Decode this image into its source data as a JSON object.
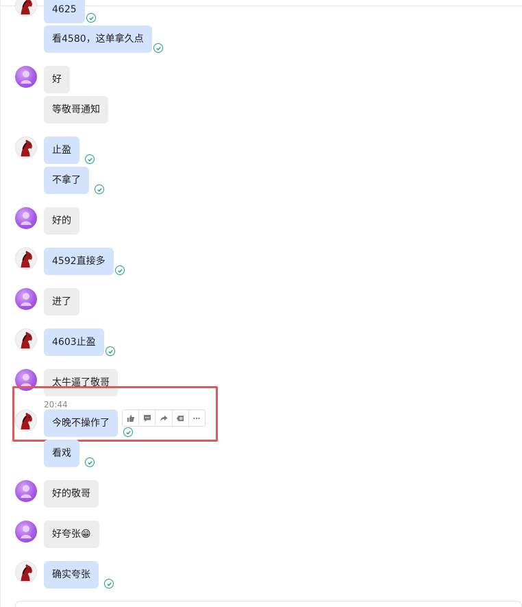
{
  "timestamp": "20:44",
  "messages": [
    {
      "text": "4625",
      "side": "mine"
    },
    {
      "text": "看4580，这单拿久点",
      "side": "mine"
    },
    {
      "text": "好",
      "side": "theirs"
    },
    {
      "text": "等敬哥通知",
      "side": "theirs"
    },
    {
      "text": "止盈",
      "side": "mine"
    },
    {
      "text": "不拿了",
      "side": "mine"
    },
    {
      "text": "好的",
      "side": "theirs"
    },
    {
      "text": "4592直接多",
      "side": "mine"
    },
    {
      "text": "进了",
      "side": "theirs"
    },
    {
      "text": "4603止盈",
      "side": "mine"
    },
    {
      "text": "太牛逼了敬哥",
      "side": "theirs"
    },
    {
      "text": "今晚不操作了",
      "side": "mine"
    },
    {
      "text": "看戏",
      "side": "mine"
    },
    {
      "text": "好的敬哥",
      "side": "theirs"
    },
    {
      "text": "好夸张",
      "side": "theirs",
      "emoji": "😁"
    },
    {
      "text": "确实夸张",
      "side": "mine"
    }
  ],
  "toolbar": {
    "icons": [
      "thumbs-up-icon",
      "comment-icon",
      "forward-icon",
      "reply-icon",
      "more-icon"
    ]
  },
  "colors": {
    "mine_bubble": "#d3e3fd",
    "theirs_bubble": "#ededed",
    "check": "#1aa37f",
    "highlight": "#e0585c"
  }
}
